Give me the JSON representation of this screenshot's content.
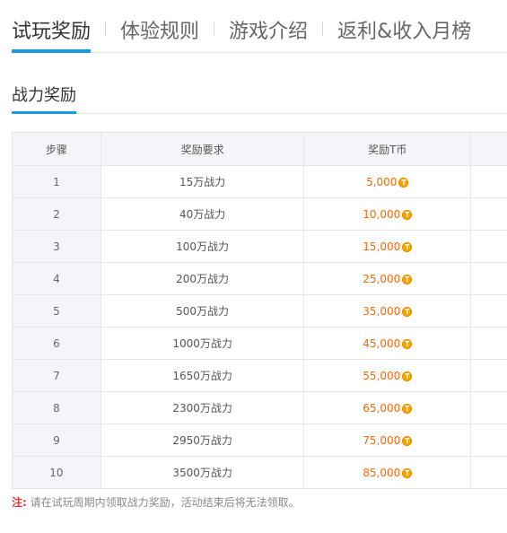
{
  "tabs": [
    {
      "label": "试玩奖励",
      "active": true
    },
    {
      "label": "体验规则",
      "active": false
    },
    {
      "label": "游戏介绍",
      "active": false
    },
    {
      "label": "返利&收入月榜",
      "active": false
    }
  ],
  "section": {
    "title": "战力奖励"
  },
  "table": {
    "headers": [
      "步骤",
      "奖励要求",
      "奖励T币"
    ],
    "coin_icon": "t-coin-icon",
    "rows": [
      {
        "step": "1",
        "requirement": "15万战力",
        "reward": "5,000"
      },
      {
        "step": "2",
        "requirement": "40万战力",
        "reward": "10,000"
      },
      {
        "step": "3",
        "requirement": "100万战力",
        "reward": "15,000"
      },
      {
        "step": "4",
        "requirement": "200万战力",
        "reward": "25,000"
      },
      {
        "step": "5",
        "requirement": "500万战力",
        "reward": "35,000"
      },
      {
        "step": "6",
        "requirement": "1000万战力",
        "reward": "45,000"
      },
      {
        "step": "7",
        "requirement": "1650万战力",
        "reward": "55,000"
      },
      {
        "step": "8",
        "requirement": "2300万战力",
        "reward": "65,000"
      },
      {
        "step": "9",
        "requirement": "2950万战力",
        "reward": "75,000"
      },
      {
        "step": "10",
        "requirement": "3500万战力",
        "reward": "85,000"
      }
    ]
  },
  "note": {
    "label": "注:",
    "text": "请在试玩周期内领取战力奖励，活动结束后将无法领取。"
  },
  "colors": {
    "accent": "#1a9ae6",
    "reward": "#ff6600",
    "note_label": "#e4393c"
  }
}
